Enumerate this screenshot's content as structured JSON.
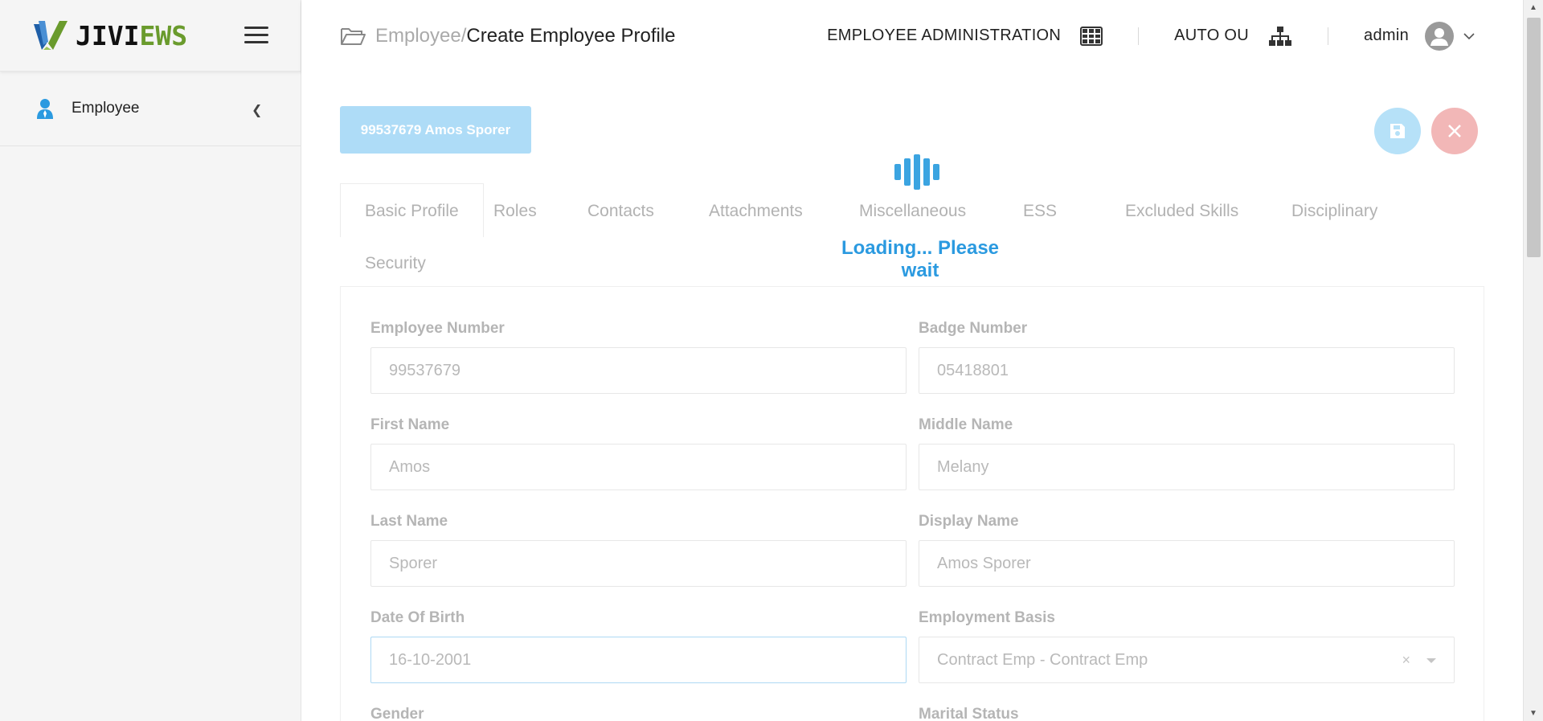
{
  "sidebar": {
    "logo": {
      "jivi": "JIVI",
      "ews": "EWS"
    },
    "items": [
      {
        "label": "Employee"
      }
    ]
  },
  "header": {
    "breadcrumb_parent": "Employee/",
    "breadcrumb_current": "Create Employee Profile",
    "module": "EMPLOYEE ADMINISTRATION",
    "org_unit": "AUTO OU",
    "user": "admin"
  },
  "profile": {
    "badge_label": "99537679 Amos Sporer"
  },
  "loading": {
    "text": "Loading... Please wait"
  },
  "tabs": [
    "Basic Profile",
    "Roles",
    "Contacts",
    "Attachments",
    "Miscellaneous",
    "ESS",
    "Excluded Skills",
    "Disciplinary",
    "Security"
  ],
  "form": {
    "employee_number": {
      "label": "Employee Number",
      "value": "99537679"
    },
    "badge_number": {
      "label": "Badge Number",
      "value": "05418801"
    },
    "first_name": {
      "label": "First Name",
      "value": "Amos"
    },
    "middle_name": {
      "label": "Middle Name",
      "value": "Melany"
    },
    "last_name": {
      "label": "Last Name",
      "value": "Sporer"
    },
    "display_name": {
      "label": "Display Name",
      "value": "Amos Sporer"
    },
    "date_of_birth": {
      "label": "Date Of Birth",
      "value": "16-10-2001"
    },
    "employment_basis": {
      "label": "Employment Basis",
      "value": "Contract Emp - Contract Emp"
    },
    "gender": {
      "label": "Gender"
    },
    "marital_status": {
      "label": "Marital Status"
    }
  },
  "colors": {
    "accent": "#2b9ae0",
    "brand_green": "#6a9b2d",
    "danger_light": "#f2b7b7",
    "primary_light": "#aedcf7"
  },
  "icons": [
    "hamburger-icon",
    "user-icon",
    "chevron-left-icon",
    "folder-open-icon",
    "grid-icon",
    "org-chart-icon",
    "user-avatar-icon",
    "chevron-down-icon",
    "save-icon",
    "close-icon",
    "loader-icon"
  ]
}
